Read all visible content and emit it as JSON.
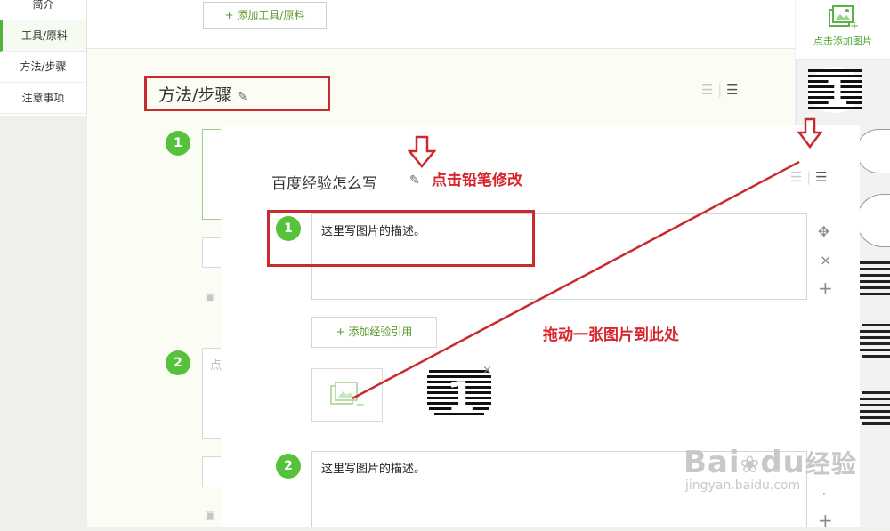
{
  "left_nav": {
    "items": [
      {
        "label": "简介"
      },
      {
        "label": "工具/原料"
      },
      {
        "label": "方法/步骤"
      },
      {
        "label": "注意事项"
      }
    ]
  },
  "editor": {
    "add_tool_button": "+ 添加工具/原料",
    "section_title": "方法/步骤",
    "steps_bg": [
      {
        "number": "1"
      },
      {
        "number": "2"
      }
    ],
    "step2_placeholder_fragment": "点"
  },
  "right_bar": {
    "add_image_label": "点击添加图片"
  },
  "overlay": {
    "title": "百度经验怎么写",
    "pencil_hint": "点击铅笔修改",
    "drag_hint": "拖动一张图片到此处",
    "add_ref_button": "+ 添加经验引用",
    "steps": [
      {
        "number": "1",
        "text": "这里写图片的描述。"
      },
      {
        "number": "2",
        "text": "这里写图片的描述。"
      }
    ],
    "step_controls": {
      "move": "✥",
      "delete": "×",
      "add": "+"
    }
  },
  "watermark": {
    "brand": "Bai",
    "brand2": "du",
    "cn": "经验",
    "url": "jingyan.baidu.com"
  },
  "colors": {
    "accent_green": "#56c23c",
    "annotation_red": "#d8262c",
    "link_green": "#5b9a2e"
  }
}
